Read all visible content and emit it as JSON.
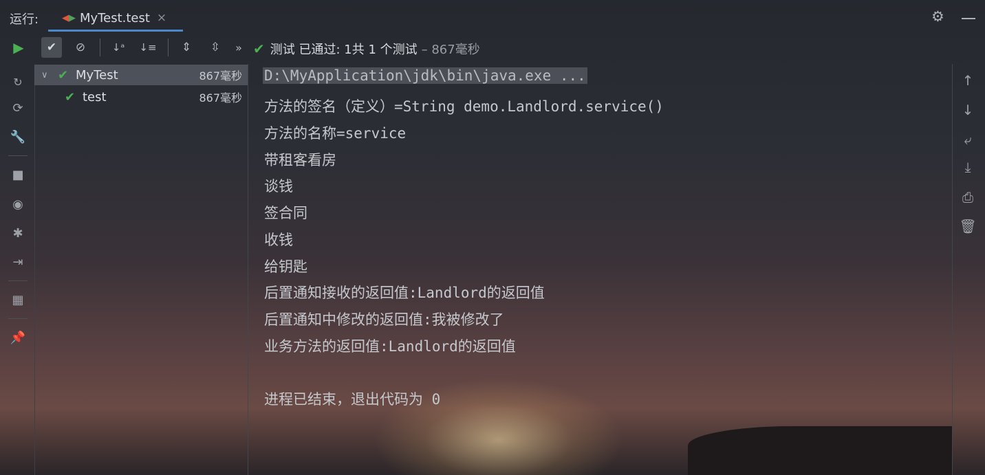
{
  "topbar": {
    "run_label": "运行:",
    "tab_title": "MyTest.test",
    "tab_close": "×"
  },
  "toolbar": {
    "status_text": "测试 已通过: 1共 1 个测试",
    "status_time": "– 867毫秒",
    "more": "»"
  },
  "tree": {
    "items": [
      {
        "name": "MyTest",
        "time": "867毫秒"
      },
      {
        "name": "test",
        "time": "867毫秒"
      }
    ]
  },
  "console": {
    "lines": [
      "D:\\MyApplication\\jdk\\bin\\java.exe ...",
      "方法的签名（定义）=String demo.Landlord.service()",
      "方法的名称=service",
      "带租客看房",
      "谈钱",
      "签合同",
      "收钱",
      "给钥匙",
      "后置通知接收的返回值:Landlord的返回值",
      "后置通知中修改的返回值:我被修改了",
      "业务方法的返回值:Landlord的返回值",
      "进程已结束，退出代码为 0"
    ]
  },
  "colors": {
    "success": "#4bb052",
    "tab_underline": "#4a88c7"
  },
  "icons": {
    "toolbar": [
      "check-icon",
      "cancel-icon",
      "sort-alpha-icon",
      "sort-duration-icon",
      "expand-all-icon",
      "collapse-all-icon"
    ],
    "left": [
      "run-icon",
      "rerun-failed-icon",
      "toggle-auto-test-icon",
      "settings-wrench-icon",
      "stop-icon",
      "camera-icon",
      "debug-icon",
      "export-icon",
      "layout-icon",
      "pin-icon"
    ],
    "right": [
      "arrow-up-icon",
      "arrow-down-icon",
      "soft-wrap-icon",
      "scroll-to-end-icon",
      "print-icon",
      "trash-icon"
    ]
  }
}
